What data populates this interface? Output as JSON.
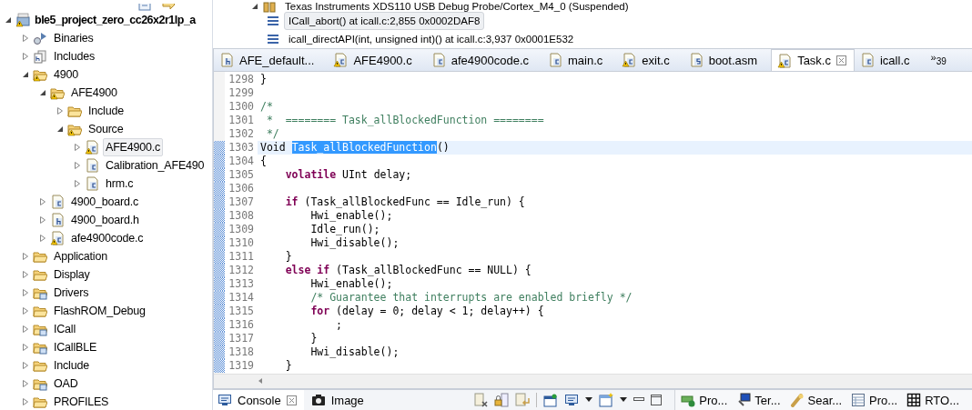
{
  "explorer": {
    "tree": [
      {
        "label": "ble5_project_zero_cc26x2r1lp_a",
        "kind": "project",
        "warning": true,
        "expanded": true,
        "selected": false,
        "children": [
          {
            "label": "Binaries",
            "kind": "binaries",
            "warning": false,
            "expanded": false,
            "selected": false
          },
          {
            "label": "Includes",
            "kind": "includes",
            "warning": false,
            "expanded": false,
            "selected": false
          },
          {
            "label": "4900",
            "kind": "folder",
            "warning": true,
            "expanded": true,
            "selected": false,
            "children": [
              {
                "label": "AFE4900",
                "kind": "folder",
                "warning": true,
                "expanded": true,
                "selected": false,
                "children": [
                  {
                    "label": "Include",
                    "kind": "folder",
                    "warning": false,
                    "expanded": false,
                    "selected": false
                  },
                  {
                    "label": "Source",
                    "kind": "folder",
                    "warning": true,
                    "expanded": true,
                    "selected": false,
                    "children": [
                      {
                        "label": "AFE4900.c",
                        "kind": "cfile",
                        "warning": true,
                        "expanded": false,
                        "selected": true
                      },
                      {
                        "label": "Calibration_AFE490",
                        "kind": "cfile",
                        "warning": false,
                        "expanded": false,
                        "selected": false
                      },
                      {
                        "label": "hrm.c",
                        "kind": "cfile",
                        "warning": false,
                        "expanded": false,
                        "selected": false
                      }
                    ]
                  }
                ]
              },
              {
                "label": "4900_board.c",
                "kind": "cfile",
                "warning": false,
                "expanded": false,
                "selected": false
              },
              {
                "label": "4900_board.h",
                "kind": "hfile",
                "warning": false,
                "expanded": false,
                "selected": false
              },
              {
                "label": "afe4900code.c",
                "kind": "cfile",
                "warning": true,
                "expanded": false,
                "selected": false
              }
            ]
          },
          {
            "label": "Application",
            "kind": "folder",
            "warning": false,
            "expanded": false,
            "selected": false
          },
          {
            "label": "Display",
            "kind": "folder",
            "warning": false,
            "expanded": false,
            "selected": false
          },
          {
            "label": "Drivers",
            "kind": "linkfolder",
            "warning": false,
            "expanded": false,
            "selected": false
          },
          {
            "label": "FlashROM_Debug",
            "kind": "folder",
            "warning": false,
            "expanded": false,
            "selected": false
          },
          {
            "label": "ICall",
            "kind": "linkfolder",
            "warning": false,
            "expanded": false,
            "selected": false
          },
          {
            "label": "ICallBLE",
            "kind": "linkfolder",
            "warning": false,
            "expanded": false,
            "selected": false
          },
          {
            "label": "Include",
            "kind": "folder",
            "warning": false,
            "expanded": false,
            "selected": false
          },
          {
            "label": "OAD",
            "kind": "linkfolder",
            "warning": false,
            "expanded": false,
            "selected": false
          },
          {
            "label": "PROFILES",
            "kind": "folder",
            "warning": false,
            "expanded": false,
            "selected": false
          }
        ]
      }
    ]
  },
  "debug": {
    "rows": [
      {
        "kind": "probe",
        "label": "Texas Instruments XDS110 USB Debug Probe/Cortex_M4_0 (Suspended)",
        "selected": false
      },
      {
        "kind": "frame",
        "label": "ICall_abort() at icall.c:2,855 0x0002DAF8",
        "selected": true
      },
      {
        "kind": "frame",
        "label": "icall_directAPI(int, unsigned int)() at icall.c:3,937 0x0001E532",
        "selected": false
      }
    ]
  },
  "editor": {
    "tabs": [
      {
        "label": "AFE_default...",
        "kind": "hfile",
        "warning": false,
        "selected": false
      },
      {
        "label": "AFE4900.c",
        "kind": "cfile",
        "warning": true,
        "selected": false
      },
      {
        "label": "afe4900code.c",
        "kind": "cfile",
        "warning": false,
        "selected": false
      },
      {
        "label": "main.c",
        "kind": "cfile",
        "warning": false,
        "selected": false
      },
      {
        "label": "exit.c",
        "kind": "cfile",
        "warning": true,
        "selected": false
      },
      {
        "label": "boot.asm",
        "kind": "sfile",
        "warning": false,
        "selected": false
      },
      {
        "label": "Task.c",
        "kind": "cfile",
        "warning": true,
        "selected": true
      },
      {
        "label": "icall.c",
        "kind": "cfile",
        "warning": false,
        "selected": false
      }
    ],
    "overflow": {
      "symbol": "»",
      "count": "39"
    },
    "lines": [
      {
        "number": "1298",
        "current": false,
        "changed": false,
        "tokens": [
          {
            "kind": "plain",
            "text": "}"
          }
        ]
      },
      {
        "number": "1299",
        "current": false,
        "changed": false
      },
      {
        "number": "1300",
        "current": false,
        "changed": false,
        "tokens": [
          {
            "kind": "comment",
            "text": "/*"
          }
        ]
      },
      {
        "number": "1301",
        "current": false,
        "changed": false,
        "tokens": [
          {
            "kind": "comment",
            "text": " *  ======== Task_allBlockedFunction ========"
          }
        ]
      },
      {
        "number": "1302",
        "current": false,
        "changed": false,
        "tokens": [
          {
            "kind": "comment",
            "text": " */"
          }
        ]
      },
      {
        "number": "1303",
        "current": true,
        "changed": true,
        "tokens": [
          {
            "kind": "plain",
            "text": "Void "
          },
          {
            "kind": "plain",
            "text": "Task_allBlockedFunction",
            "selected": true
          },
          {
            "kind": "plain",
            "text": "()"
          }
        ]
      },
      {
        "number": "1304",
        "current": false,
        "changed": true,
        "tokens": [
          {
            "kind": "plain",
            "text": "{"
          }
        ]
      },
      {
        "number": "1305",
        "current": false,
        "changed": true,
        "tokens": [
          {
            "kind": "keyword",
            "text": "    volatile"
          },
          {
            "kind": "plain",
            "text": " UInt delay;"
          }
        ]
      },
      {
        "number": "1306",
        "current": false,
        "changed": true
      },
      {
        "number": "1307",
        "current": false,
        "changed": true,
        "tokens": [
          {
            "kind": "keyword",
            "text": "    if"
          },
          {
            "kind": "plain",
            "text": " (Task_allBlockedFunc == Idle_run) {"
          }
        ]
      },
      {
        "number": "1308",
        "current": false,
        "changed": true,
        "tokens": [
          {
            "kind": "plain",
            "text": "        Hwi_enable();"
          }
        ]
      },
      {
        "number": "1309",
        "current": false,
        "changed": true,
        "tokens": [
          {
            "kind": "plain",
            "text": "        Idle_run();"
          }
        ]
      },
      {
        "number": "1310",
        "current": false,
        "changed": true,
        "tokens": [
          {
            "kind": "plain",
            "text": "        Hwi_disable();"
          }
        ]
      },
      {
        "number": "1311",
        "current": false,
        "changed": true,
        "tokens": [
          {
            "kind": "plain",
            "text": "    }"
          }
        ]
      },
      {
        "number": "1312",
        "current": false,
        "changed": true,
        "tokens": [
          {
            "kind": "keyword",
            "text": "    else if"
          },
          {
            "kind": "plain",
            "text": " (Task_allBlockedFunc == NULL) {"
          }
        ]
      },
      {
        "number": "1313",
        "current": false,
        "changed": true,
        "tokens": [
          {
            "kind": "plain",
            "text": "        Hwi_enable();"
          }
        ]
      },
      {
        "number": "1314",
        "current": false,
        "changed": true,
        "tokens": [
          {
            "kind": "comment",
            "text": "        /* Guarantee that interrupts are enabled briefly */"
          }
        ]
      },
      {
        "number": "1315",
        "current": false,
        "changed": true,
        "tokens": [
          {
            "kind": "keyword",
            "text": "        for"
          },
          {
            "kind": "plain",
            "text": " (delay = 0; delay < 1; delay++) {"
          }
        ]
      },
      {
        "number": "1316",
        "current": false,
        "changed": true,
        "tokens": [
          {
            "kind": "plain",
            "text": "            ;"
          }
        ]
      },
      {
        "number": "1317",
        "current": false,
        "changed": true,
        "tokens": [
          {
            "kind": "plain",
            "text": "        }"
          }
        ]
      },
      {
        "number": "1318",
        "current": false,
        "changed": true,
        "tokens": [
          {
            "kind": "plain",
            "text": "        Hwi_disable();"
          }
        ]
      },
      {
        "number": "1319",
        "current": false,
        "changed": true,
        "tokens": [
          {
            "kind": "plain",
            "text": "    }"
          }
        ]
      }
    ]
  },
  "bottom_panel": {
    "tabs": [
      {
        "label": "Console",
        "kind": "console",
        "closable": true,
        "selected": true
      },
      {
        "label": "Image",
        "kind": "camera",
        "closable": false,
        "selected": false
      }
    ],
    "views": [
      {
        "label": "Pro...",
        "kind": "progress"
      },
      {
        "label": "Ter...",
        "kind": "terminal"
      },
      {
        "label": "Sear...",
        "kind": "search"
      },
      {
        "label": "Pro...",
        "kind": "properties"
      },
      {
        "label": "RTO...",
        "kind": "grid"
      }
    ]
  }
}
